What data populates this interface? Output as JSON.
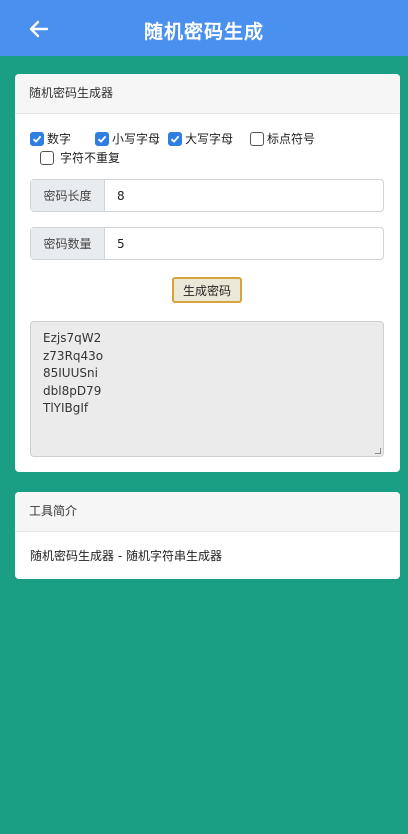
{
  "header": {
    "title": "随机密码生成",
    "back_icon": "arrow-left-icon"
  },
  "generator": {
    "title": "随机密码生成器",
    "options": [
      {
        "label": "数字",
        "checked": true
      },
      {
        "label": "小写字母",
        "checked": true
      },
      {
        "label": "大写字母",
        "checked": true
      },
      {
        "label": "标点符号",
        "checked": false
      },
      {
        "label": "字符不重复",
        "checked": false
      }
    ],
    "length": {
      "label": "密码长度",
      "value": "8"
    },
    "count": {
      "label": "密码数量",
      "value": "5"
    },
    "generate_label": "生成密码",
    "results": [
      "Ezjs7qW2",
      "z73Rq43o",
      "85IUUSni",
      "dbl8pD79",
      "TlYIBgIf"
    ]
  },
  "intro": {
    "title": "工具简介",
    "text": "随机密码生成器 - 随机字符串生成器"
  },
  "colors": {
    "header_bg": "#4a90ee",
    "page_bg": "#1a9e84",
    "checkbox_on": "#2f7fe0",
    "button_border": "#d8a23c"
  }
}
